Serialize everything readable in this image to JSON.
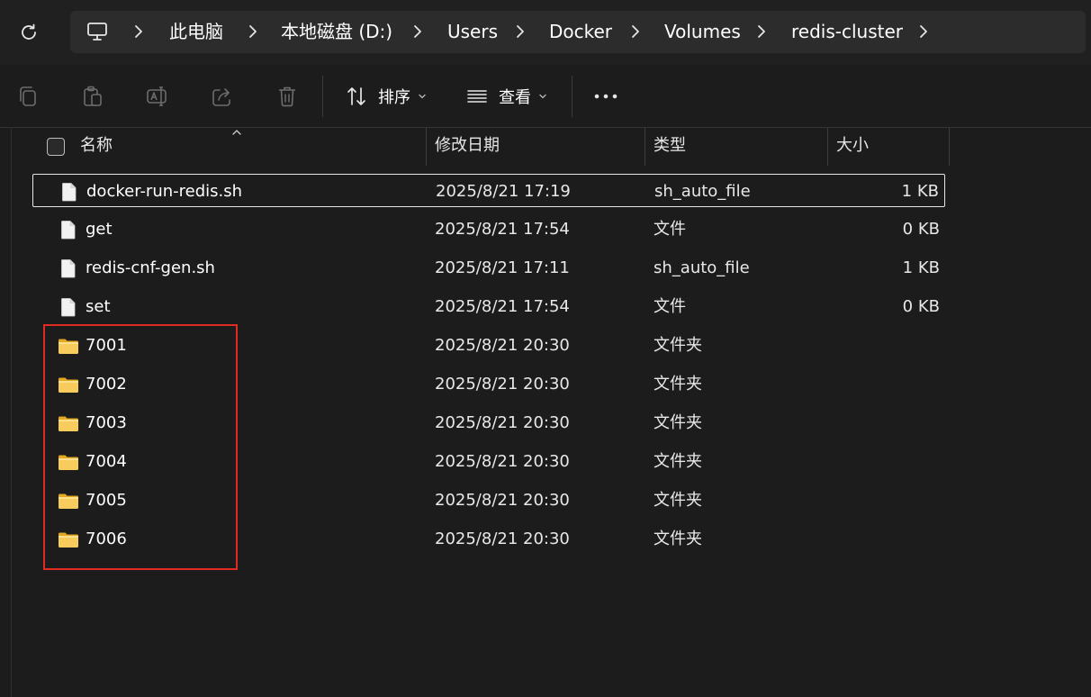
{
  "breadcrumb": [
    "此电脑",
    "本地磁盘 (D:)",
    "Users",
    "Docker",
    "Volumes",
    "redis-cluster"
  ],
  "toolbar": {
    "sort_label": "排序",
    "view_label": "查看"
  },
  "columns": {
    "name": "名称",
    "modified": "修改日期",
    "type": "类型",
    "size": "大小"
  },
  "files": [
    {
      "name": "docker-run-redis.sh",
      "modified": "2025/8/21 17:19",
      "type": "sh_auto_file",
      "size": "1 KB",
      "kind": "file",
      "selected": true
    },
    {
      "name": "get",
      "modified": "2025/8/21 17:54",
      "type": "文件",
      "size": "0 KB",
      "kind": "file"
    },
    {
      "name": "redis-cnf-gen.sh",
      "modified": "2025/8/21 17:11",
      "type": "sh_auto_file",
      "size": "1 KB",
      "kind": "file"
    },
    {
      "name": "set",
      "modified": "2025/8/21 17:54",
      "type": "文件",
      "size": "0 KB",
      "kind": "file"
    },
    {
      "name": "7001",
      "modified": "2025/8/21 20:30",
      "type": "文件夹",
      "size": "",
      "kind": "folder"
    },
    {
      "name": "7002",
      "modified": "2025/8/21 20:30",
      "type": "文件夹",
      "size": "",
      "kind": "folder"
    },
    {
      "name": "7003",
      "modified": "2025/8/21 20:30",
      "type": "文件夹",
      "size": "",
      "kind": "folder"
    },
    {
      "name": "7004",
      "modified": "2025/8/21 20:30",
      "type": "文件夹",
      "size": "",
      "kind": "folder"
    },
    {
      "name": "7005",
      "modified": "2025/8/21 20:30",
      "type": "文件夹",
      "size": "",
      "kind": "folder"
    },
    {
      "name": "7006",
      "modified": "2025/8/21 20:30",
      "type": "文件夹",
      "size": "",
      "kind": "folder"
    }
  ],
  "icons": {
    "refresh": "refresh-icon",
    "computer": "computer-icon",
    "copy": "copy-icon",
    "paste": "paste-icon",
    "rename": "rename-icon",
    "share": "share-icon",
    "delete": "delete-icon",
    "sort": "sort-icon",
    "view": "view-icon",
    "more": "more-icon",
    "file": "file-icon",
    "folder": "folder-icon"
  },
  "colors": {
    "background": "#1c1c1c",
    "annotation_box": "#e02a22",
    "folder": "#f3c85a"
  }
}
